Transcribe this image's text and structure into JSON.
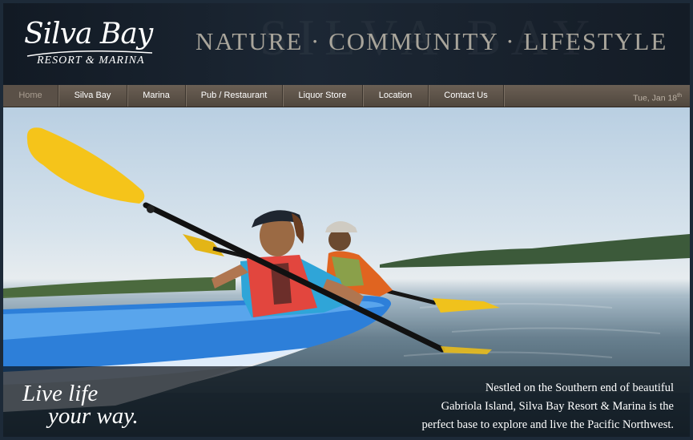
{
  "header": {
    "watermark": "SILVA BAY",
    "logo_script": "Silva Bay",
    "logo_sub": "RESORT & MARINA",
    "tagline": "NATURE · COMMUNITY · LIFESTYLE"
  },
  "nav": {
    "items": [
      {
        "label": "Home",
        "active": true
      },
      {
        "label": "Silva Bay"
      },
      {
        "label": "Marina"
      },
      {
        "label": "Pub / Restaurant"
      },
      {
        "label": "Liquor Store"
      },
      {
        "label": "Location"
      },
      {
        "label": "Contact Us"
      }
    ],
    "date": "Tue, Jan 18",
    "date_suffix": "th"
  },
  "hero": {
    "caption_left_line1": "Live life",
    "caption_left_line2": "your way.",
    "caption_right": [
      "Nestled on the Southern end of beautiful",
      "Gabriola Island, Silva Bay Resort & Marina is the",
      "perfect base to explore and live the Pacific Northwest."
    ]
  },
  "colors": {
    "nav_bg": "#5e544a",
    "tagline": "#a9a59b",
    "kayak_blue": "#2d7fd9",
    "paddle_yellow": "#f2c21a"
  }
}
